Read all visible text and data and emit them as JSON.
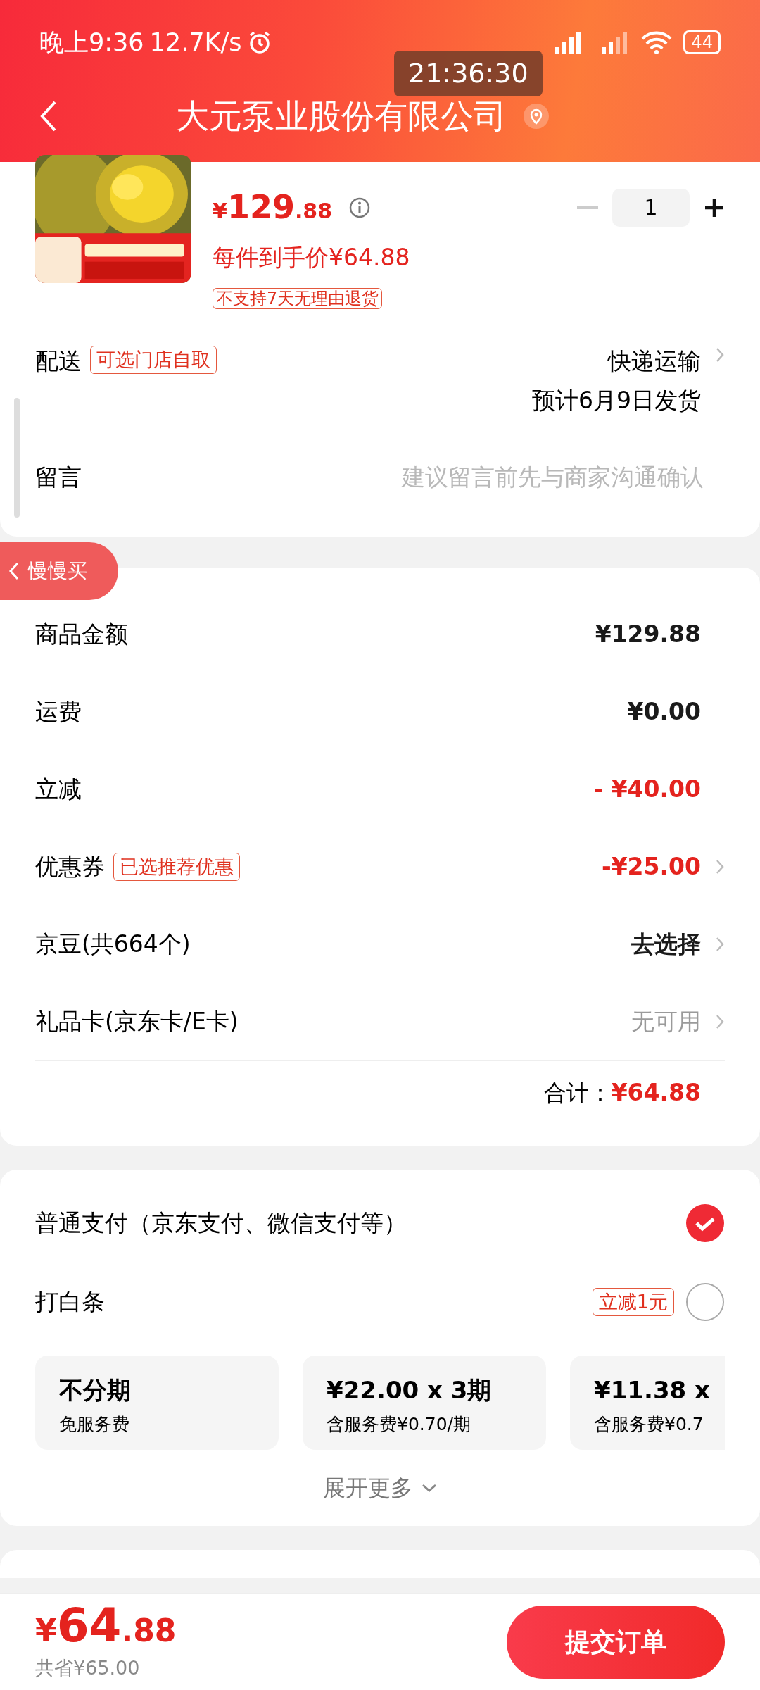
{
  "status_bar": {
    "time": "晚上9:36",
    "speed": "12.7K/s",
    "battery": "44"
  },
  "clock_overlay": "21:36:30",
  "header": {
    "title": "大元泵业股份有限公司"
  },
  "product": {
    "price": {
      "currency": "¥",
      "whole": "129",
      "fraction": ".88"
    },
    "unit_price": "每件到手价¥64.88",
    "tag": "不支持7天无理由退货",
    "quantity": "1"
  },
  "delivery": {
    "label": "配送",
    "tag": "可选门店自取",
    "method": "快递运输",
    "eta": "预计6月9日发货"
  },
  "note": {
    "label": "留言",
    "placeholder": "建议留言前先与商家沟通确认"
  },
  "float_tab": "慢慢买",
  "summary": {
    "rows": [
      {
        "label": "商品金额",
        "value": "¥129.88",
        "kind": "plain",
        "arrow": false
      },
      {
        "label": "运费",
        "value": "¥0.00",
        "kind": "plain",
        "arrow": false
      },
      {
        "label": "立减",
        "value": "- ¥40.00",
        "kind": "discount",
        "arrow": false
      },
      {
        "label": "优惠券",
        "tag": "已选推荐优惠",
        "value": "-¥25.00",
        "kind": "discount",
        "arrow": true
      },
      {
        "label": "京豆(共664个)",
        "value": "去选择",
        "kind": "plain",
        "arrow": true
      },
      {
        "label": "礼品卡(京东卡/E卡)",
        "value": "无可用",
        "kind": "unavailable",
        "arrow": true
      }
    ],
    "total_label": "合计：",
    "total": "¥64.88"
  },
  "payment": {
    "methods": [
      {
        "label": "普通支付（京东支付、微信支付等）",
        "selected": true
      },
      {
        "label": "打白条",
        "tag": "立减1元",
        "selected": false
      }
    ],
    "plans": [
      {
        "title": "不分期",
        "subtitle": "免服务费"
      },
      {
        "title": "¥22.00 x 3期",
        "subtitle": "含服务费¥0.70/期"
      },
      {
        "title": "¥11.38 x",
        "subtitle": "含服务费¥0.7"
      }
    ],
    "expand": "展开更多"
  },
  "footer": {
    "price": {
      "currency": "¥",
      "whole": "64",
      "fraction": ".88"
    },
    "saved": "共省¥65.00",
    "submit": "提交订单"
  }
}
